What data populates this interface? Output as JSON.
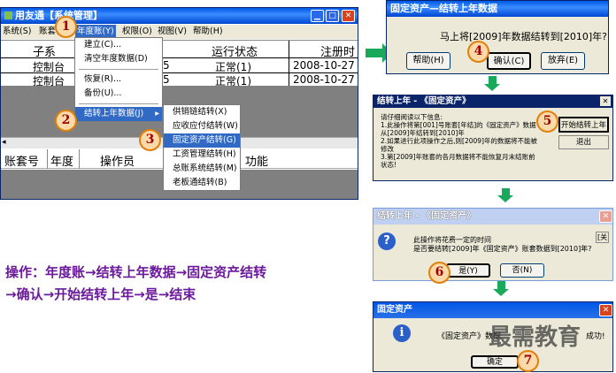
{
  "main_window": {
    "title": "用友通【系统管理】",
    "menubar": [
      "系统(S)",
      "账套(A)",
      "年度账(Y)",
      "权限(O)",
      "视图(V)",
      "帮助(H)"
    ],
    "table_headers": [
      "子系",
      "运行状态",
      "注册时"
    ],
    "rows": [
      {
        "name": "控制台",
        "suffix": "5",
        "status": "正常(1)",
        "date": "2008-10-27 2"
      },
      {
        "name": "控制台",
        "suffix": "5",
        "status": "正常(1)",
        "date": "2008-10-27 2"
      }
    ],
    "bottom_headers": [
      "账套号",
      "年度",
      "操作员",
      "功能"
    ]
  },
  "year_menu": {
    "items": [
      "建立(C)...",
      "清空年度数据(D)",
      "恢复(R)...",
      "备份(U)...",
      "结转上年数据(J)"
    ]
  },
  "carry_submenu": {
    "items": [
      "供销链结转(X)",
      "应收应付结转(W)",
      "固定资产结转(G)",
      "工资管理结转(H)",
      "总账系统结转(M)",
      "老板通结转(B)"
    ]
  },
  "dialog1": {
    "title": "固定资产—结转上年数据",
    "message": "马上将[2009]年数据结转到[2010]年?",
    "buttons": [
      "帮助(H)",
      "确认(C)",
      "放弃(E)"
    ]
  },
  "dialog2": {
    "title": "结转上年 - 《固定资产》",
    "info": "请仔细阅读以下信息:\n1.此操作将第[001]号账套[年结]的《固定资产》数据从[2009]年结转到[2010]年\n2.如果进行此项操作之后,则[2009]年的数据将不能被修改\n3.第[2009]年账套的各月数据将不能恢复月末结账前状态!",
    "buttons": [
      "开始结转上年",
      "退出"
    ]
  },
  "dialog3": {
    "title": "结转上年 - 《固定资产》",
    "line1": "此操作将花费一定的时间",
    "line2": "是否要结转[2009]年《固定资产》账套数据到[2010]年?",
    "side": "[关",
    "buttons": [
      "是(Y)",
      "否(N)"
    ]
  },
  "dialog4": {
    "title": "固定资产",
    "message": "《固定资产》数据",
    "suffix": "成功!",
    "button": "确定"
  },
  "steps": [
    "1",
    "2",
    "3",
    "4",
    "5",
    "6",
    "7"
  ],
  "instruction": {
    "line1": "操作：年度账→结转上年数据→固定资产结转",
    "line2": "→确认→开始结转上年→是→结束"
  },
  "watermark": "最需教育",
  "colors": {
    "accent": "#0a246a",
    "step_border": "#e0800a",
    "arrow": "#1aa85a",
    "instruction": "#6a1a9a"
  }
}
